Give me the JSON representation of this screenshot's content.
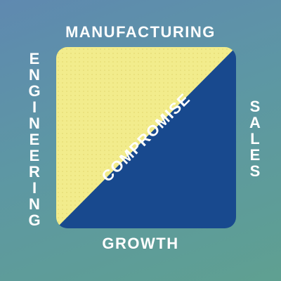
{
  "labels": {
    "top": "MANUFACTURING",
    "bottom": "GROWTH",
    "left": "ENGINEERING",
    "right": "SALES",
    "center": "COMPROMISE"
  },
  "colors": {
    "upper_triangle": "#f2ec8c",
    "lower_triangle": "#18498e",
    "text": "#ffffff"
  }
}
